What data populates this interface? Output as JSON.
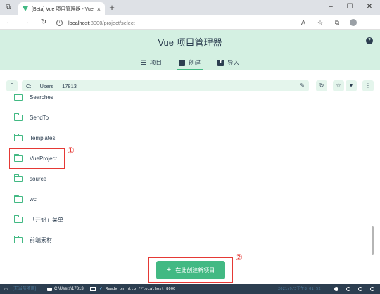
{
  "browser": {
    "tab_title": "[Beta] Vue 项目管理器 - Vue CLI",
    "url_host": "localhost",
    "url_path": ":8000/project/select",
    "icons": {
      "window": "window-menu-icon",
      "close_tab": "×",
      "new_tab": "+",
      "minimize": "–",
      "maximize": "☐",
      "close": "✕",
      "back": "←",
      "forward": "→",
      "reload": "↻",
      "info": "i",
      "read_aloud": "A",
      "favorite": "☆",
      "collections": "⧉",
      "more": "···"
    }
  },
  "app": {
    "title": "Vue 项目管理器",
    "help": "?",
    "tabs": [
      {
        "label": "项目",
        "icon": "☰"
      },
      {
        "label": "创建",
        "icon": "+"
      },
      {
        "label": "导入",
        "icon": "⬆"
      }
    ],
    "active_tab": "创建",
    "accent": "#42b983"
  },
  "path": {
    "up": "⌃",
    "crumbs": [
      "C:",
      "Users",
      "17813"
    ],
    "edit": "✎",
    "refresh": "↻",
    "star": "☆",
    "dropdown": "▾",
    "more": "⋮"
  },
  "folders": [
    "Searches",
    "SendTo",
    "Templates",
    "VueProject",
    "source",
    "wc",
    "「开始」菜单",
    "前端素材"
  ],
  "annotations": {
    "one": "①",
    "two": "②"
  },
  "create_button": {
    "plus": "+",
    "label": "在此创建新项目"
  },
  "status_bar": {
    "home": "⌂",
    "no_project": "[无当前项目]",
    "folder_path": "C:\\Users\\17813",
    "ready": "Ready on http://localhost:8000",
    "datetime": "2021/9/3下午8:01:52"
  }
}
